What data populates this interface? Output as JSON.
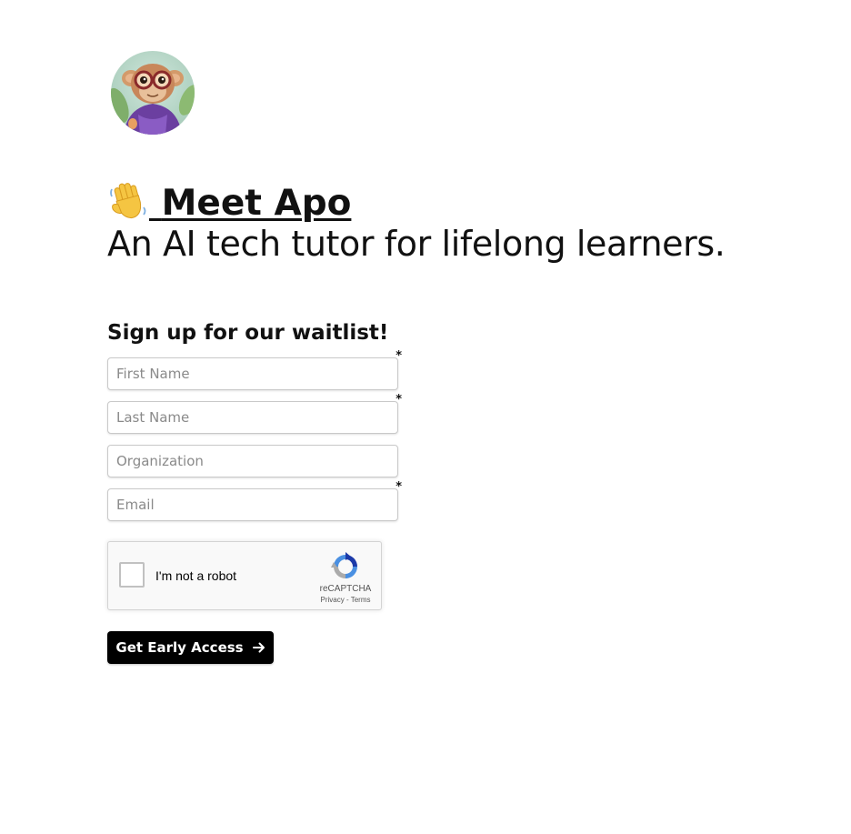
{
  "header": {
    "title_link": "Meet Apo",
    "subtitle": "An AI tech tutor for lifelong learners."
  },
  "form": {
    "title": "Sign up for our waitlist!",
    "fields": [
      {
        "name": "first-name",
        "placeholder": "First Name",
        "value": "",
        "required": true
      },
      {
        "name": "last-name",
        "placeholder": "Last Name",
        "value": "",
        "required": true
      },
      {
        "name": "organization",
        "placeholder": "Organization",
        "value": "",
        "required": false
      },
      {
        "name": "email",
        "placeholder": "Email",
        "value": "",
        "required": true
      }
    ],
    "required_marker": "*",
    "captcha": {
      "label": "I'm not a robot",
      "brand": "reCAPTCHA",
      "privacy": "Privacy",
      "separator": "-",
      "terms": "Terms",
      "checked": false
    },
    "submit_label": "Get Early Access"
  },
  "icons": {
    "avatar": "monkey-mascot-avatar",
    "title_emoji": "waving-hand-icon",
    "submit": "arrow-right-icon",
    "captcha": "recaptcha-logo-icon"
  },
  "colors": {
    "text": "#111111",
    "button_bg": "#000000",
    "button_text": "#ffffff",
    "input_border": "#c9c9c9",
    "captcha_blue": "#4a90e2"
  }
}
